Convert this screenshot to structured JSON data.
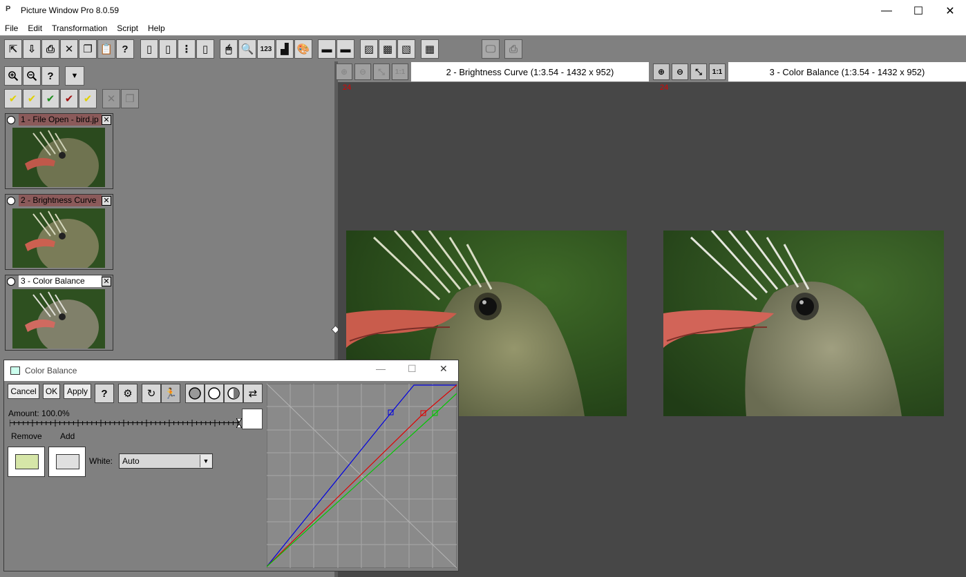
{
  "window": {
    "title": "Picture Window Pro 8.0.59",
    "app_icon_glyph": "P",
    "controls": {
      "minimize": "—",
      "maximize": "☐",
      "close": "✕"
    }
  },
  "menu": [
    "File",
    "Edit",
    "Transformation",
    "Script",
    "Help"
  ],
  "toolbar": {
    "buttons": [
      {
        "name": "open-file-icon",
        "glyph": "⇱",
        "disabled": false
      },
      {
        "name": "save-icon",
        "glyph": "⇩",
        "disabled": false
      },
      {
        "name": "print-icon",
        "glyph": "⎙",
        "disabled": false
      },
      {
        "name": "close-x-icon",
        "glyph": "✕",
        "disabled": false
      },
      {
        "name": "copy-icon",
        "glyph": "❐",
        "disabled": false
      },
      {
        "name": "paste-icon",
        "glyph": "📋",
        "disabled": true
      },
      {
        "name": "help-icon",
        "glyph": "?",
        "disabled": false
      },
      {
        "name": "layout-left-icon",
        "glyph": "▯",
        "disabled": false
      },
      {
        "name": "layout-single-icon",
        "glyph": "▯",
        "disabled": false
      },
      {
        "name": "layout-vertical-icon",
        "glyph": "⋮",
        "disabled": false
      },
      {
        "name": "layout-split-icon",
        "glyph": "▯",
        "disabled": false
      },
      {
        "name": "mouse-icon",
        "glyph": "🖱",
        "disabled": false
      },
      {
        "name": "magnifier-icon",
        "glyph": "🔍",
        "disabled": false
      },
      {
        "name": "numbers-icon",
        "glyph": "123",
        "disabled": false
      },
      {
        "name": "histogram-icon",
        "glyph": "▟",
        "disabled": false
      },
      {
        "name": "palette-icon",
        "glyph": "🎨",
        "disabled": false
      },
      {
        "name": "gradient-red-icon",
        "glyph": "▬",
        "disabled": false
      },
      {
        "name": "gradient-cyan-icon",
        "glyph": "▬",
        "disabled": false
      },
      {
        "name": "hatch-1-icon",
        "glyph": "▨",
        "disabled": false
      },
      {
        "name": "hatch-2-icon",
        "glyph": "▩",
        "disabled": false
      },
      {
        "name": "hatch-3-icon",
        "glyph": "▧",
        "disabled": false
      },
      {
        "name": "grid-icon",
        "glyph": "▦",
        "disabled": false
      },
      {
        "name": "monitor-icon",
        "glyph": "🖵",
        "disabled": true
      },
      {
        "name": "printer-disabled-icon",
        "glyph": "⎙",
        "disabled": true
      }
    ]
  },
  "left_panel": {
    "zoom_in": "🔍+",
    "zoom_out": "🔍-",
    "help": "?",
    "dropdown": "▼",
    "checks": [
      "✔",
      "✔",
      "✔",
      "✔",
      "✔"
    ],
    "thumbnails": [
      {
        "label": "1 - File Open - bird.jp",
        "highlight": "#8b5a5a"
      },
      {
        "label": "2 - Brightness Curve",
        "highlight": "#8b5a5a"
      },
      {
        "label": "3 - Color Balance",
        "highlight": "#ffffff"
      }
    ]
  },
  "panes": [
    {
      "title": "2 - Brightness Curve (1:3.54 - 1432 x 952)",
      "number": "24"
    },
    {
      "title": "3 - Color Balance (1:3.54 - 1432 x 952)",
      "number": "24"
    }
  ],
  "pane_zoom": {
    "in": "⊕",
    "out": "⊖",
    "fit": "⤡",
    "one_to_one": "1:1"
  },
  "dialog": {
    "title": "Color Balance",
    "buttons": {
      "cancel": "Cancel",
      "ok": "OK",
      "apply": "Apply"
    },
    "amount_label": "Amount: 100.0%",
    "amount_value": 1.0,
    "remove_label": "Remove",
    "add_label": "Add",
    "white_label": "White:",
    "white_value": "Auto",
    "remove_color": "#d6e6a8",
    "add_color": "#e0e0e0"
  }
}
